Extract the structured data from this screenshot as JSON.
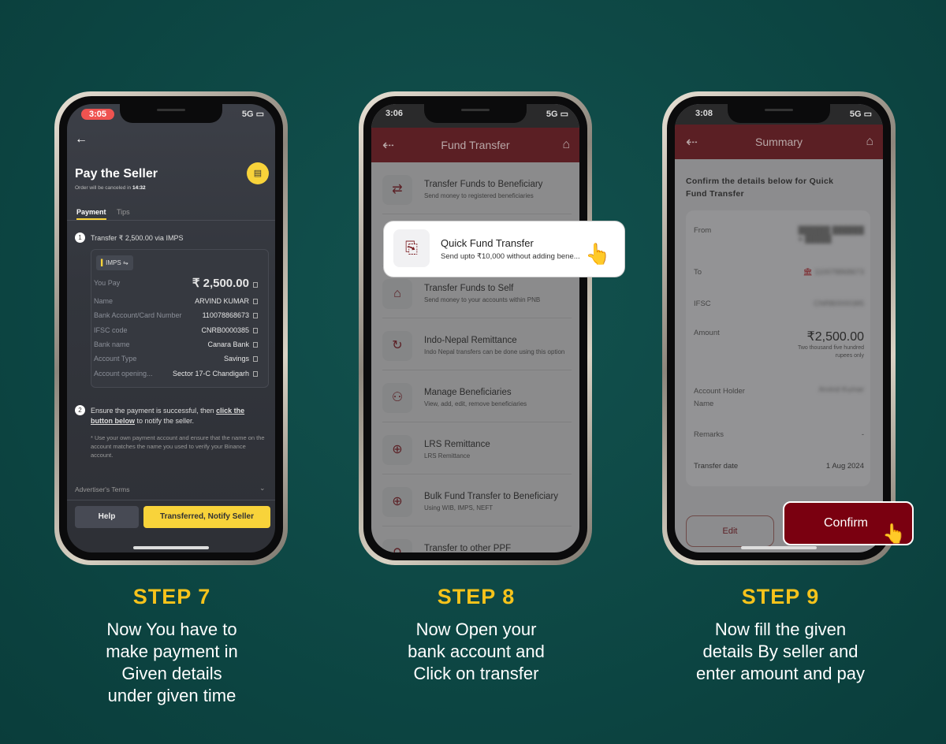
{
  "steps": [
    {
      "title": "STEP 7",
      "lines": [
        "Now You have to",
        "make payment in",
        "Given details",
        "under given time"
      ]
    },
    {
      "title": "STEP 8",
      "lines": [
        "Now Open your",
        "bank account and",
        "Click on transfer"
      ]
    },
    {
      "title": "STEP 9",
      "lines": [
        "Now fill the given",
        "details By seller and",
        "enter amount and pay"
      ]
    }
  ],
  "colors": {
    "background": "#0d4744",
    "step_title": "#f6c31b",
    "binance_yellow": "#f8d33a",
    "pnb_maroon": "#5b1f24",
    "confirm": "#7a0010"
  },
  "phone1": {
    "time": "3:05",
    "network": "5G",
    "title": "Pay the Seller",
    "cancel_prefix": "Order will be canceled in",
    "cancel_time": "14:32",
    "tabs": [
      "Payment",
      "Tips"
    ],
    "step1": "Transfer ₹ 2,500.00 via IMPS",
    "method": "IMPS",
    "you_pay_label": "You Pay",
    "you_pay_value": "₹ 2,500.00",
    "rows": [
      [
        "Name",
        "ARVIND KUMAR"
      ],
      [
        "Bank Account/Card Number",
        "110078868673"
      ],
      [
        "IFSC code",
        "CNRB0000385"
      ],
      [
        "Bank name",
        "Canara Bank"
      ],
      [
        "Account Type",
        "Savings"
      ],
      [
        "Account opening...",
        "Sector 17-C Chandigarh"
      ]
    ],
    "step2_a": "Ensure the payment is successful, then",
    "step2_link1": "click the",
    "step2_link2": "button below",
    "step2_b": "to notify the seller.",
    "note": "* Use your own payment account and ensure that the name on the account matches the name you used to verify your Binance account.",
    "terms": "Advertiser's Terms",
    "help": "Help",
    "notify": "Transferred, Notify Seller"
  },
  "phone2": {
    "time": "3:06",
    "network": "5G",
    "title": "Fund Transfer",
    "items": [
      {
        "title": "Transfer Funds to Beneficiary",
        "sub": "Send money to registered beneficiaries",
        "icon": "transfer-icon"
      },
      {
        "title": "Quick Fund Transfer",
        "sub": "Send upto ₹10,000 without adding bene...",
        "icon": "quick-transfer-icon"
      },
      {
        "title": "Transfer Funds to Self",
        "sub": "Send money to your accounts within PNB",
        "icon": "bank-self-icon"
      },
      {
        "title": "Indo-Nepal Remittance",
        "sub": "Indo Nepal transfers can be done using this option",
        "icon": "exchange-icon"
      },
      {
        "title": "Manage Beneficiaries",
        "sub": "View, add, edit, remove beneficiaries",
        "icon": "user-gear-icon"
      },
      {
        "title": "LRS Remittance",
        "sub": "LRS Remittance",
        "icon": "globe-icon"
      },
      {
        "title": "Bulk Fund Transfer to Beneficiary",
        "sub": "Using WIB, IMPS, NEFT",
        "icon": "globe-icon"
      },
      {
        "title": "Transfer to other PPF",
        "sub": "",
        "icon": "ppf-icon"
      }
    ]
  },
  "phone3": {
    "time": "3:08",
    "network": "5G",
    "title": "Summary",
    "heading": "Confirm the details below for Quick Fund Transfer",
    "from_label": "From",
    "to_label": "To",
    "ifsc_label": "IFSC",
    "amount_label": "Amount",
    "amount_value": "2,500.00",
    "amount_words": "Two thousand five hundred rupees only",
    "holder_label": "Account Holder Name",
    "remarks_label": "Remarks",
    "remarks_value": "-",
    "date_label": "Transfer date",
    "date_value": "1 Aug 2024",
    "edit": "Edit",
    "confirm": "Confirm"
  }
}
